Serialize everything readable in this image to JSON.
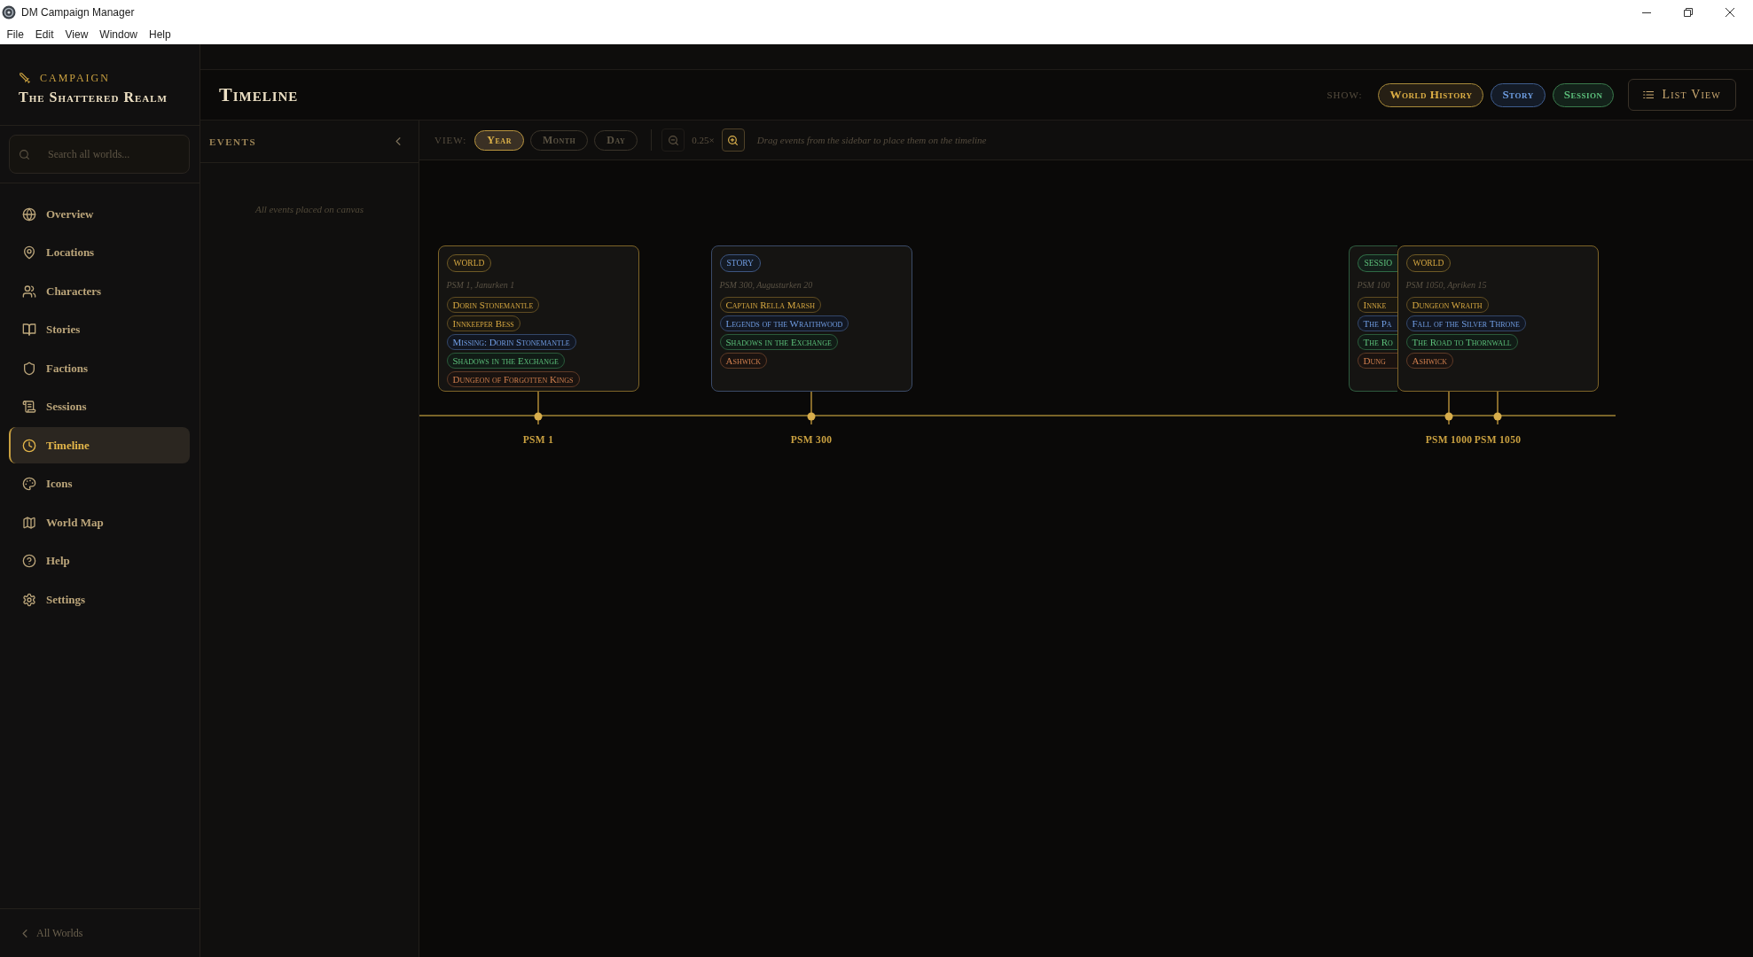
{
  "window": {
    "title": "DM Campaign Manager",
    "menu": [
      "File",
      "Edit",
      "View",
      "Window",
      "Help"
    ]
  },
  "sidebar": {
    "campaign_label": "CAMPAIGN",
    "campaign_name": "The Shattered Realm",
    "search": {
      "placeholder": "Search all worlds..."
    },
    "items": [
      {
        "label": "Overview",
        "selected": false
      },
      {
        "label": "Locations",
        "selected": false
      },
      {
        "label": "Characters",
        "selected": false
      },
      {
        "label": "Stories",
        "selected": false
      },
      {
        "label": "Factions",
        "selected": false
      },
      {
        "label": "Sessions",
        "selected": false
      },
      {
        "label": "Timeline",
        "selected": true
      },
      {
        "label": "Icons",
        "selected": false
      },
      {
        "label": "World Map",
        "selected": false
      },
      {
        "label": "Help",
        "selected": false
      },
      {
        "label": "Settings",
        "selected": false
      }
    ],
    "footer_link": "All Worlds"
  },
  "header": {
    "title": "Timeline",
    "show_label": "SHOW:",
    "filters": [
      {
        "label": "World History",
        "kind": "world",
        "selected": true
      },
      {
        "label": "Story",
        "kind": "story",
        "selected": true
      },
      {
        "label": "Session",
        "kind": "session",
        "selected": true
      }
    ],
    "list_view_button": "List View"
  },
  "events_panel": {
    "title": "EVENTS",
    "empty_message": "All events placed on canvas"
  },
  "toolbar": {
    "view_label": "VIEW:",
    "views": [
      {
        "label": "Year",
        "selected": true
      },
      {
        "label": "Month",
        "selected": false
      },
      {
        "label": "Day",
        "selected": false
      }
    ],
    "zoom_out": {
      "disabled": true
    },
    "zoom_level": "0.25×",
    "zoom_in": {
      "disabled": false
    },
    "hint": "Drag events from the sidebar to place them on the timeline"
  },
  "timeline": {
    "events": [
      {
        "kind": "world",
        "type_label": "WORLD",
        "date": "PSM 1, Janurken 1",
        "tags": [
          {
            "label": "Dorin Stonemantle",
            "kind": "character"
          },
          {
            "label": "Innkeeper Bess",
            "kind": "character"
          },
          {
            "label": "Missing: Dorin Stonemantle",
            "kind": "story"
          },
          {
            "label": "Shadows in the Exchange",
            "kind": "session"
          },
          {
            "label": "Dungeon of Forgotten Kings",
            "kind": "location"
          }
        ],
        "marker_label": "PSM 1"
      },
      {
        "kind": "story",
        "type_label": "STORY",
        "date": "PSM 300, Augusturken 20",
        "tags": [
          {
            "label": "Captain Rella Marsh",
            "kind": "character"
          },
          {
            "label": "Legends of the Wraithwood",
            "kind": "story"
          },
          {
            "label": "Shadows in the Exchange",
            "kind": "session"
          },
          {
            "label": "Ashwick",
            "kind": "location"
          }
        ],
        "marker_label": "PSM 300"
      },
      {
        "kind": "session",
        "type_label": "SESSIO",
        "date": "PSM 100",
        "tags": [
          {
            "label": "Innke",
            "kind": "character"
          },
          {
            "label": "The Pa",
            "kind": "story"
          },
          {
            "label": "The Ro",
            "kind": "session"
          },
          {
            "label": "Dung",
            "kind": "location"
          }
        ],
        "marker_label": "PSM 1000"
      },
      {
        "kind": "world",
        "type_label": "WORLD",
        "date": "PSM 1050, Apriken 15",
        "tags": [
          {
            "label": "Dungeon Wraith",
            "kind": "character"
          },
          {
            "label": "Fall of the Silver Throne",
            "kind": "story"
          },
          {
            "label": "The Road to Thornwall",
            "kind": "session"
          },
          {
            "label": "Ashwick",
            "kind": "location"
          }
        ],
        "marker_label": "PSM 1050"
      }
    ]
  }
}
